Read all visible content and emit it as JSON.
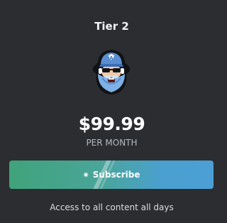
{
  "tier": {
    "title": "Tier 2",
    "mascot_icon": "bearded-sailor-mascot-icon",
    "price": "$99.99",
    "period": "PER MONTH",
    "subscribe_label": "Subscribe",
    "subscribe_icon": "sparkle-icon",
    "description": "Access to all content all days"
  },
  "colors": {
    "background": "#2b2d31",
    "button_gradient_start": "#3fa37a",
    "button_gradient_end": "#4b9fd5"
  }
}
